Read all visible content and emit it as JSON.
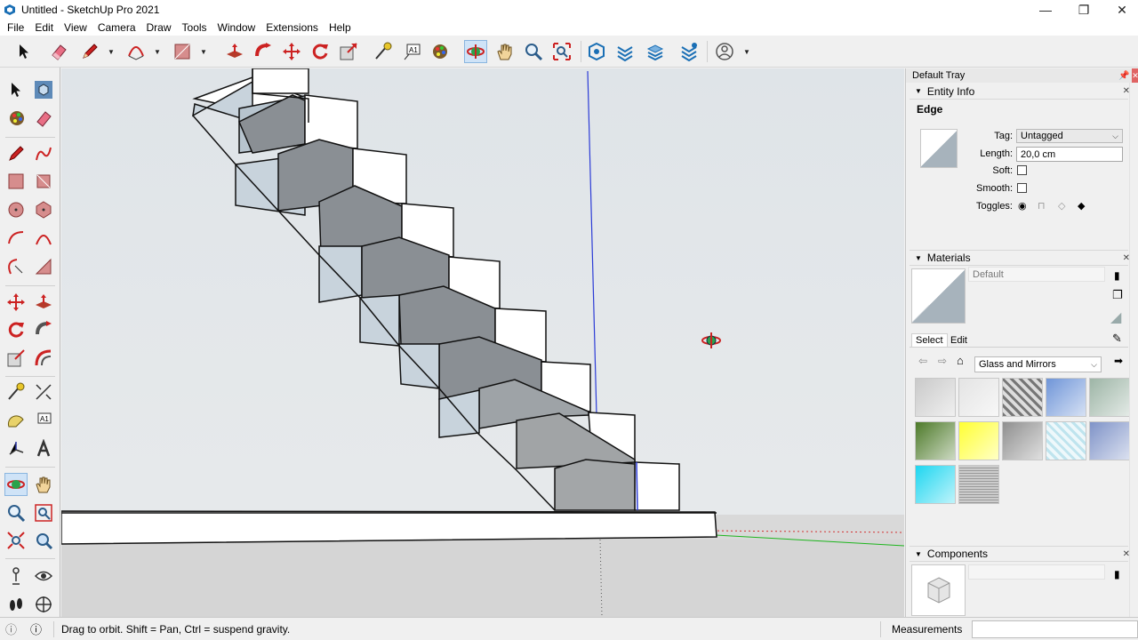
{
  "window": {
    "title": "Untitled - SketchUp Pro 2021",
    "minimize": "—",
    "maximize": "❐",
    "close": "✕"
  },
  "menu": [
    "File",
    "Edit",
    "View",
    "Camera",
    "Draw",
    "Tools",
    "Window",
    "Extensions",
    "Help"
  ],
  "menu_underline": [
    "F",
    "E",
    "V",
    "C",
    "D",
    "T",
    "W",
    "x",
    "H"
  ],
  "tray": {
    "title": "Default Tray",
    "entity_info": {
      "header": "Entity Info",
      "entity_type": "Edge",
      "tag_label": "Tag:",
      "tag_value": "Untagged",
      "length_label": "Length:",
      "length_value": "20,0 cm",
      "soft_label": "Soft:",
      "smooth_label": "Smooth:",
      "toggles_label": "Toggles:"
    },
    "materials": {
      "header": "Materials",
      "material_name": "Default",
      "tab_select": "Select",
      "tab_edit": "Edit",
      "collection": "Glass and Mirrors",
      "swatch_colors": [
        "#c9c9c9",
        "#e4e4e4",
        "#9a9a9a",
        "#6f95d8",
        "#9db5a6",
        "#4d7a29",
        "#ffff33",
        "#8f8f8f",
        "#d6eef4",
        "#7f93c8",
        "#1ed6f0",
        "#b9b9b9"
      ]
    },
    "components": {
      "header": "Components"
    }
  },
  "status": {
    "hint": "Drag to orbit. Shift = Pan, Ctrl = suspend gravity.",
    "measurements_label": "Measurements"
  },
  "colors": {
    "accent_active": "#cfe3f7",
    "axis_blue": "#2b3bd6",
    "axis_green": "#1db51d",
    "axis_red": "#d23232"
  }
}
